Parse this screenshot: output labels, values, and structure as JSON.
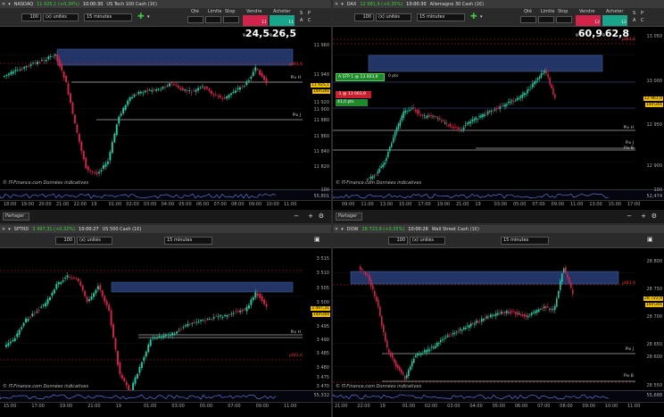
{
  "panels": {
    "nasdaq": {
      "ticker": "NASDAQ",
      "price": "11 925,1 (+0,34%)",
      "time": "10:00:30",
      "name": "US Tech 100 Cash (1€)",
      "qty": "100",
      "units": "(x) unités",
      "tf": "15 minutes",
      "qte": "Qté",
      "limite": "Limite",
      "stop": "Stop",
      "vendre": "Vendre",
      "acheter": "Acheter",
      "sell_small": "11 9",
      "sell_big": "24,5",
      "buy_small": "11 9",
      "buy_big": "26,5"
    },
    "dax": {
      "ticker": "DAX",
      "price": "12 981,9 (+0,35%)",
      "time": "10:00:30",
      "name": "Allemagne 30 Cash (1€)",
      "qty": "100",
      "units": "(x) unités",
      "tf": "15 minutes",
      "qte": "Qté",
      "limite": "Limite",
      "stop": "Stop",
      "vendre": "Vendre",
      "acheter": "Acheter",
      "sell_small": "12 9",
      "sell_big": "60,9",
      "buy_small": "12 9",
      "buy_big": "62,8"
    },
    "sptrd": {
      "ticker": "SPTRD",
      "price": "3 497,31 (+0,32%)",
      "time": "10:00:27",
      "name": "US 500 Cash (1€)",
      "qty": "100",
      "units": "(x) unités",
      "tf": "15 minutes"
    },
    "dow": {
      "ticker": "DOW",
      "price": "28 723,9 (+0,35%)",
      "time": "10:00:26",
      "name": "Wall Street Cash (1€)",
      "qty": "100",
      "units": "(x) unités",
      "tf": "15 minutes"
    }
  },
  "nasdaq_axis": [
    "11 960",
    "11 940",
    "11 920",
    "11 900",
    "11 880",
    "11 860",
    "11 840",
    "11 820"
  ],
  "nasdaq_tags": {
    "last": "11 925,1",
    "box": "14m30s",
    "pivh": "Piv H",
    "pivj": "Piv J",
    "pred": "ptB1,6"
  },
  "nasdaq_x": [
    "18:00",
    "19:00",
    "20:00",
    "21:00",
    "22:00",
    "19",
    "01:00",
    "02:00",
    "03:00",
    "04:00",
    "05:00",
    "06:00",
    "07:00",
    "08:00",
    "09:00",
    "10:00",
    "11:00"
  ],
  "dax_axis": [
    "13 050",
    "13 000",
    "12 950",
    "12 900",
    "12 850"
  ],
  "dax_tags": {
    "last": "12 961,9",
    "box": "14m30s",
    "pivh": "Piv H",
    "pivj": "Piv J",
    "pivb": "Piv B",
    "pred": "ptB1,6"
  },
  "dax_x": [
    "09:00",
    "11:00",
    "13:00",
    "15:00",
    "17:00",
    "19:00",
    "21:00",
    "19",
    "03:00",
    "05:00",
    "07:00",
    "09:00",
    "11:00",
    "13:00",
    "15:00",
    "17:00"
  ],
  "dax_order": {
    "label": "A STP 1 @ 13 003,9",
    "pts": "0 pts",
    "label2": "-1 @ 13 003,9",
    "label3": "41,0 pts"
  },
  "sptrd_axis": [
    "3 515",
    "3 510",
    "3 505",
    "3 500",
    "3 495",
    "3 490",
    "3 485",
    "3 480",
    "3 475",
    "3 470"
  ],
  "sptrd_tags": {
    "last": "3 497,31",
    "box": "14m30s",
    "pivh": "Piv H",
    "pred": "ptB1,6"
  },
  "sptrd_x": [
    "15:00",
    "17:00",
    "19:00",
    "21:00",
    "19",
    "01:00",
    "03:00",
    "05:00",
    "07:00",
    "09:00",
    "11:00"
  ],
  "dow_axis": [
    "28 800",
    "28 750",
    "28 700",
    "28 650",
    "28 600",
    "28 550"
  ],
  "dow_tags": {
    "last": "28 722,9",
    "box": "14m30s",
    "pivj": "Piv J",
    "pivb": "Piv B",
    "pred": "ptB1,6"
  },
  "dow_x": [
    "21:00",
    "22:00",
    "19",
    "01:00",
    "02:00",
    "03:00",
    "04:00",
    "05:00",
    "06:00",
    "07:00",
    "08:00",
    "09:00",
    "10:00",
    "11:00"
  ],
  "footer": {
    "copy": "© IT-Finance.com Données indicatives",
    "partager": "Partager"
  },
  "ind_vals": {
    "nasdaq": "55,801",
    "dax": "52,474",
    "sptrd": "55,332",
    "dow": "55,688",
    "ind_top": "100"
  },
  "colors": {
    "up": "#27c6a0",
    "down": "#d2234a",
    "zone": "#2a3f7a",
    "pivot": "#ffffff",
    "red_dash": "#c81f2f"
  }
}
